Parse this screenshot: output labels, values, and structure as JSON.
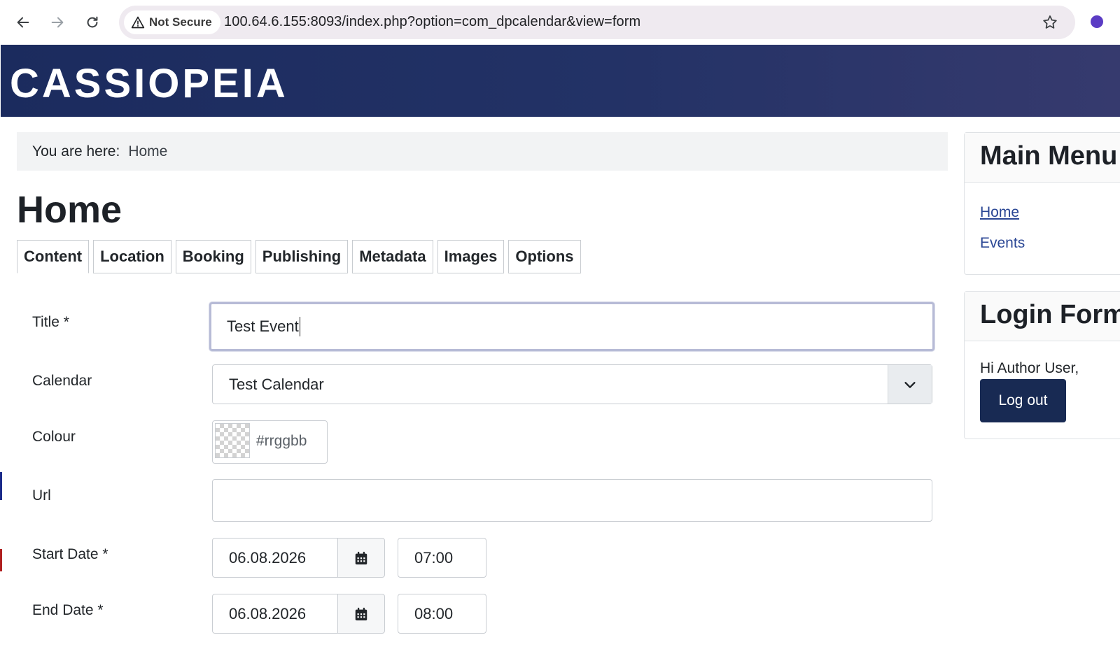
{
  "browser": {
    "security_label": "Not Secure",
    "url": "100.64.6.155:8093/index.php?option=com_dpcalendar&view=form"
  },
  "site": {
    "brand": "CASSIOPEIA",
    "brand_gradient": [
      "#1b2b5e",
      "#363a6e"
    ]
  },
  "breadcrumb": {
    "label": "You are here:",
    "items": [
      "Home"
    ]
  },
  "page": {
    "title": "Home"
  },
  "tabs": [
    {
      "label": "Content",
      "active": true
    },
    {
      "label": "Location"
    },
    {
      "label": "Booking"
    },
    {
      "label": "Publishing"
    },
    {
      "label": "Metadata"
    },
    {
      "label": "Images"
    },
    {
      "label": "Options"
    }
  ],
  "form": {
    "title": {
      "label": "Title *",
      "value": "Test Event"
    },
    "calendar": {
      "label": "Calendar",
      "value": "Test Calendar"
    },
    "colour": {
      "label": "Colour",
      "placeholder": "#rrggbb"
    },
    "url": {
      "label": "Url",
      "value": ""
    },
    "start_date": {
      "label": "Start Date *",
      "date": "06.08.2026",
      "time": "07:00"
    },
    "end_date": {
      "label": "End Date *",
      "date": "06.08.2026",
      "time": "08:00"
    }
  },
  "sidebar": {
    "main_menu": {
      "title": "Main Menu",
      "items": [
        {
          "label": "Home",
          "current": true
        },
        {
          "label": "Events"
        }
      ]
    },
    "login_form": {
      "title": "Login Form",
      "greeting": "Hi Author User,",
      "logout_label": "Log out"
    }
  },
  "colors": {
    "link": "#2a4694",
    "button": "#182a53"
  },
  "icons": [
    "back-arrow-icon",
    "forward-arrow-icon",
    "reload-icon",
    "warning-icon",
    "star-icon",
    "chevron-down-icon",
    "calendar-icon"
  ]
}
